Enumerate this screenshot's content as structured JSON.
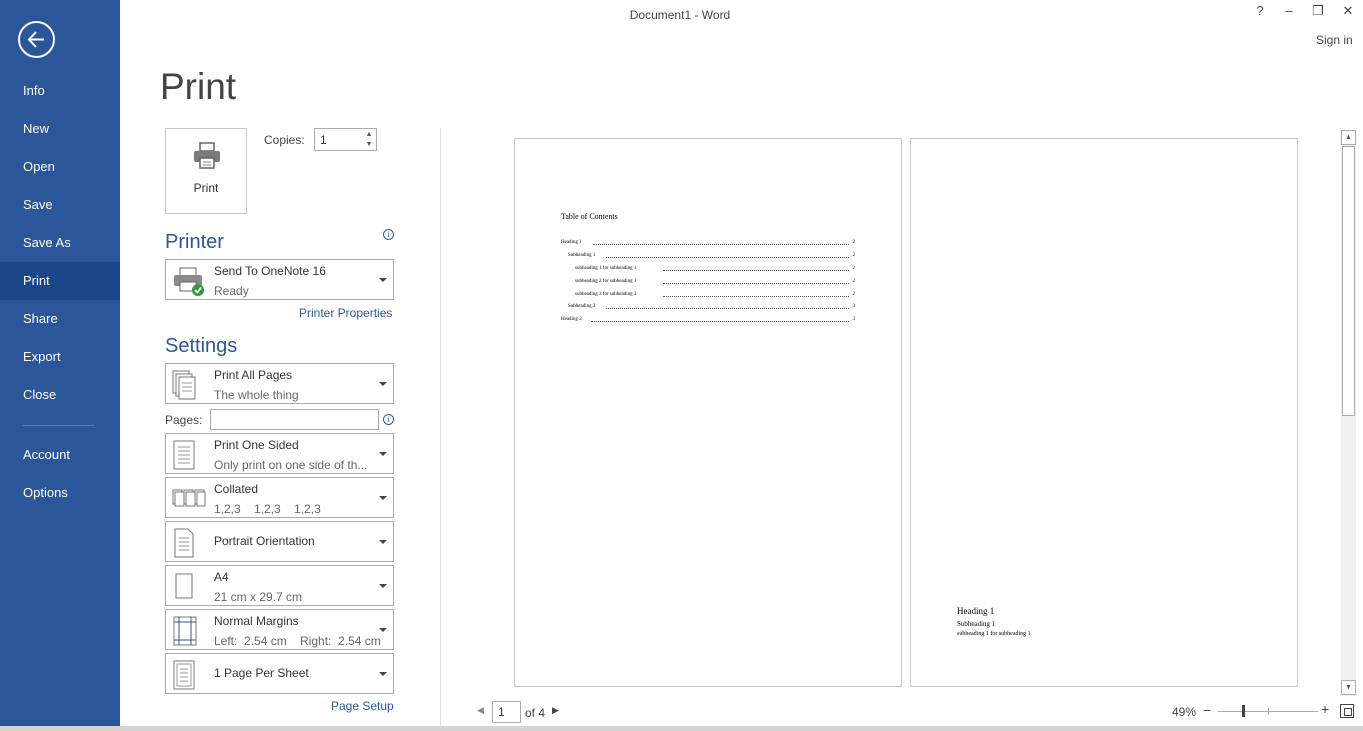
{
  "window": {
    "title": "Document1 - Word",
    "help": "?",
    "minimize": "–",
    "restore": "❐",
    "close": "✕",
    "sign_in": "Sign in"
  },
  "nav": {
    "back_icon": "back-arrow-icon",
    "items": [
      "Info",
      "New",
      "Open",
      "Save",
      "Save As",
      "Print",
      "Share",
      "Export",
      "Close",
      "Account",
      "Options"
    ],
    "active": "Print",
    "bg_color": "#2b579a",
    "active_color": "#19478a"
  },
  "page_title": "Print",
  "print_button": {
    "label": "Print",
    "icon": "printer-icon"
  },
  "copies": {
    "label": "Copies:",
    "value": "1"
  },
  "printer": {
    "heading": "Printer",
    "name": "Send To OneNote 16",
    "status": "Ready",
    "properties_link": "Printer Properties"
  },
  "settings": {
    "heading": "Settings",
    "range": {
      "main": "Print All Pages",
      "sub": "The whole thing"
    },
    "pages": {
      "label": "Pages:",
      "value": ""
    },
    "sides": {
      "main": "Print One Sided",
      "sub": "Only print on one side of th..."
    },
    "collation": {
      "main": "Collated",
      "sub": "1,2,3    1,2,3    1,2,3"
    },
    "orientation": {
      "main": "Portrait Orientation"
    },
    "paper": {
      "main": "A4",
      "sub": "21 cm x 29.7 cm"
    },
    "margins": {
      "main": "Normal Margins",
      "sub": "Left:  2.54 cm    Right:  2.54 cm"
    },
    "per_sheet": {
      "main": "1 Page Per Sheet"
    },
    "page_setup_link": "Page Setup"
  },
  "preview": {
    "page1": {
      "toc_title": "Table of Contents",
      "entries": [
        {
          "text": "Heading 1",
          "page": "2"
        },
        {
          "text": "Subheading 1",
          "page": "2"
        },
        {
          "text": "subheading 1 for subheading 1",
          "page": "2"
        },
        {
          "text": "subheading 2 for subheading 1",
          "page": "2"
        },
        {
          "text": "subheading 3 for subheading 1",
          "page": "2"
        },
        {
          "text": "Subheading 2",
          "page": "3"
        },
        {
          "text": "Heading 2",
          "page": "3"
        }
      ]
    },
    "page2": {
      "lines": [
        "Heading 1",
        "Subheading 1",
        "subheading 1 for subheading 1"
      ]
    }
  },
  "page_nav": {
    "current": "1",
    "of": "of 4",
    "prev": "◀",
    "next": "▶"
  },
  "scroll": {
    "up": "▲",
    "down": "▼"
  },
  "zoom": {
    "level": "49%",
    "out": "−",
    "in": "+"
  }
}
